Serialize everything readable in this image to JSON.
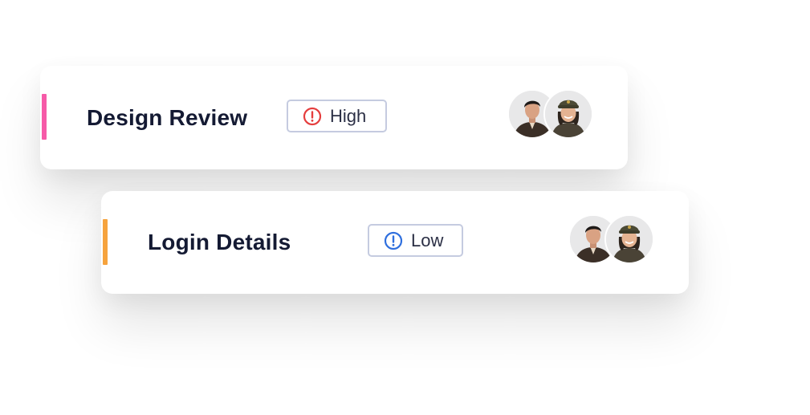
{
  "tasks": [
    {
      "title": "Design Review",
      "accent_color": "#f65aa8",
      "priority": {
        "label": "High",
        "icon": "alert-circle-icon",
        "color": "#e53e3e"
      },
      "assignees": [
        "man-avatar",
        "woman-cap-avatar"
      ]
    },
    {
      "title": "Login Details",
      "accent_color": "#f6a33d",
      "priority": {
        "label": "Low",
        "icon": "alert-circle-icon",
        "color": "#2f6fde"
      },
      "assignees": [
        "man-avatar",
        "woman-cap-avatar"
      ]
    }
  ]
}
